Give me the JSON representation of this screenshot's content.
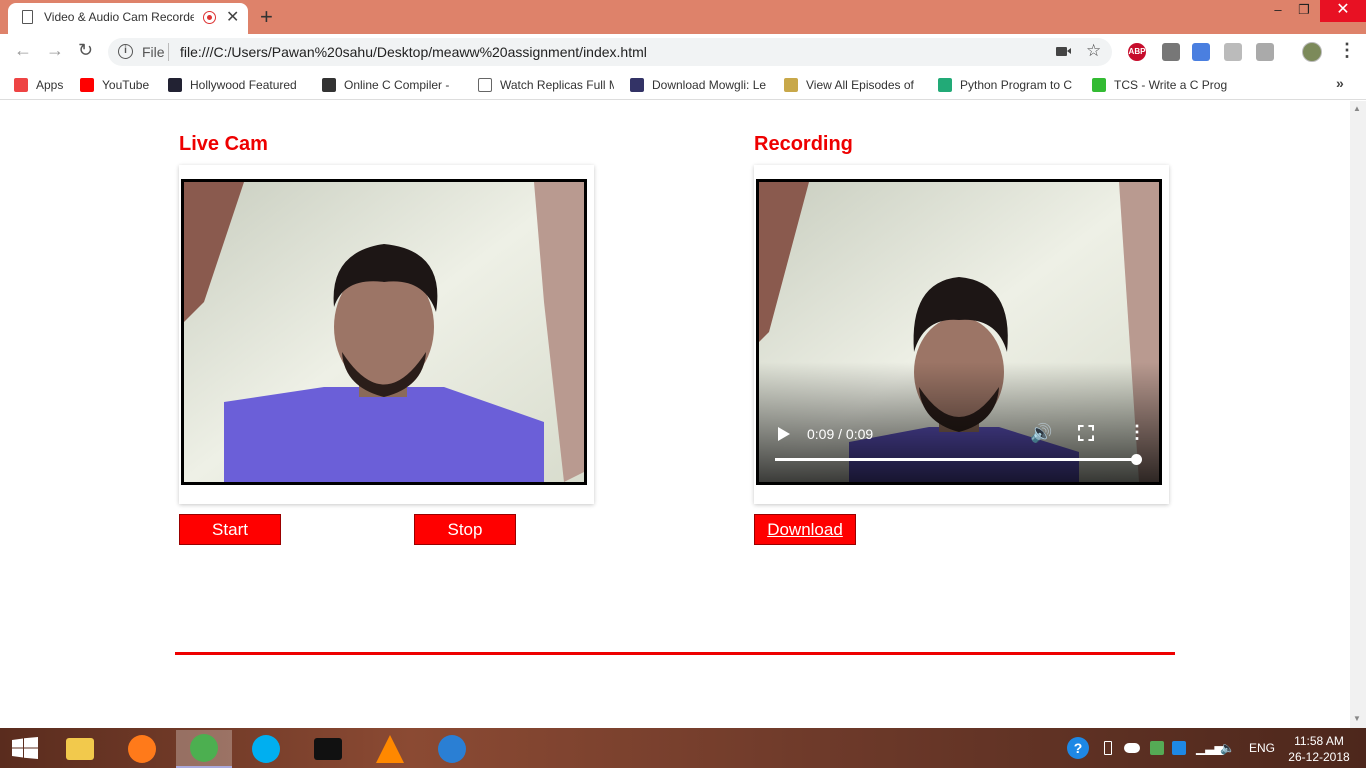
{
  "browser": {
    "tab_title": "Video & Audio Cam Recorder",
    "tab_close": "✕",
    "new_tab": "+",
    "window_controls": {
      "minimize": "–",
      "restore": "❐",
      "close": "✕"
    },
    "scheme_label": "File",
    "url": "file:///C:/Users/Pawan%20sahu/Desktop/meaww%20assignment/index.html",
    "extensions": {
      "abp": "ABP"
    },
    "bookmarks": [
      {
        "label": "Apps",
        "icon": "apps-grid-icon",
        "color": "#e44"
      },
      {
        "label": "YouTube",
        "icon": "youtube-icon",
        "color": "#f00"
      },
      {
        "label": "Hollywood Featured",
        "icon": "hollywood-icon",
        "color": "#223"
      },
      {
        "label": "Online C Compiler -",
        "icon": "compiler-icon",
        "color": "#333"
      },
      {
        "label": "Watch Replicas Full M",
        "icon": "page-icon",
        "color": "#fff"
      },
      {
        "label": "Download Mowgli: Le",
        "icon": "mowgli-icon",
        "color": "#336"
      },
      {
        "label": "View All Episodes of",
        "icon": "episodes-icon",
        "color": "#c8a84a"
      },
      {
        "label": "Python Program to C",
        "icon": "python-icon",
        "color": "#2a7"
      },
      {
        "label": "TCS - Write a C Prog",
        "icon": "tcs-icon",
        "color": "#3b3"
      }
    ],
    "bookmarks_more": "»"
  },
  "page": {
    "live_heading": "Live Cam",
    "recording_heading": "Recording",
    "start_label": "Start",
    "stop_label": "Stop",
    "download_label": "Download",
    "video_time": "0:09 / 0:09",
    "video_progress": 1.0,
    "accent_color": "#ff0000"
  },
  "taskbar": {
    "apps": [
      "file-explorer-icon",
      "firefox-icon",
      "chrome-icon",
      "skype-icon",
      "terminal-icon",
      "vlc-icon",
      "vscode-icon"
    ],
    "active_app": "chrome-icon",
    "language": "ENG",
    "time": "11:58 AM",
    "date": "26-12-2018"
  }
}
